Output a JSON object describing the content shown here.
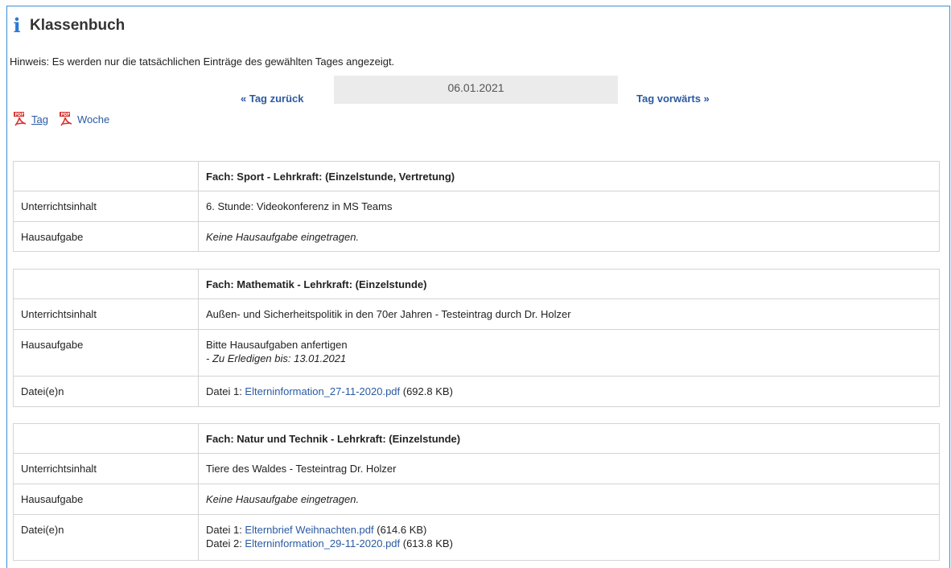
{
  "page": {
    "title": "Klassenbuch",
    "hint": "Hinweis: Es werden nur die tatsächlichen Einträge des gewählten Tages angezeigt."
  },
  "nav": {
    "back_label": "« Tag zurück",
    "date": "06.01.2021",
    "forward_label": "Tag vorwärts »"
  },
  "exports": {
    "day_label": "Tag",
    "week_label": "Woche"
  },
  "icons": {
    "title": "info-icon",
    "export": "pdf-icon"
  },
  "colors": {
    "accent": "#2b7bd4",
    "link": "#2b5aa3",
    "border": "#3c8fd4",
    "date_bg": "#ebebeb"
  },
  "labels": {
    "content": "Unterrichtsinhalt",
    "homework": "Hausaufgabe",
    "files": "Datei(e)n"
  },
  "entries": [
    {
      "header": "Fach: Sport - Lehrkraft: (Einzelstunde, Vertretung)",
      "content": "6. Stunde: Videokonferenz in MS Teams",
      "homework": "Keine Hausaufgabe eingetragen."
    },
    {
      "header": "Fach: Mathematik - Lehrkraft: (Einzelstunde)",
      "content": "Außen- und Sicherheitspolitik in den 70er Jahren - Testeintrag durch Dr. Holzer",
      "homework": "Bitte Hausaufgaben anfertigen",
      "homework_due": "- Zu Erledigen bis: 13.01.2021",
      "files": [
        {
          "prefix": "Datei 1: ",
          "name": "Elterninformation_27-11-2020.pdf",
          "size": " (692.8 KB)"
        }
      ]
    },
    {
      "header": "Fach: Natur und Technik - Lehrkraft: (Einzelstunde)",
      "content": "Tiere des Waldes - Testeintrag Dr. Holzer",
      "homework": "Keine Hausaufgabe eingetragen.",
      "files": [
        {
          "prefix": "Datei 1: ",
          "name": "Elternbrief Weihnachten.pdf",
          "size": " (614.6 KB)"
        },
        {
          "prefix": "Datei 2: ",
          "name": "Elterninformation_29-11-2020.pdf",
          "size": " (613.8 KB)"
        }
      ]
    }
  ]
}
